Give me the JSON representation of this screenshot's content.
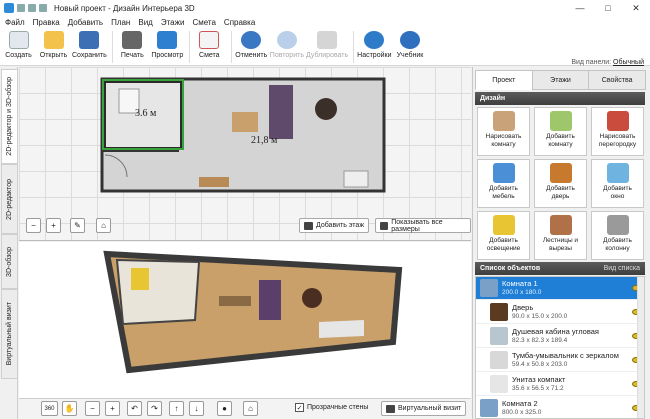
{
  "window": {
    "title": "Новый проект - Дизайн Интерьера 3D"
  },
  "menu": [
    "Файл",
    "Правка",
    "Добавить",
    "План",
    "Вид",
    "Этажи",
    "Смета",
    "Справка"
  ],
  "toolbar": {
    "create": "Создать",
    "open": "Открыть",
    "save": "Сохранить",
    "print": "Печать",
    "preview": "Просмотр",
    "estimate": "Смета",
    "undo": "Отменить",
    "redo": "Повторить",
    "duplicate": "Дублировать",
    "settings": "Настройки",
    "tutorial": "Учебник",
    "panel_view_label": "Вид панели:",
    "panel_view_value": "Обычный"
  },
  "left_tabs": [
    "2D-редактор и 3D-обзор",
    "2D-редактор",
    "3D-обзор",
    "Виртуальный визит"
  ],
  "plan2d": {
    "room_small_label": "3.6 м",
    "room_main_label": "21,8 м",
    "add_floor": "Добавить этаж",
    "show_all_sizes": "Показывать все размеры"
  },
  "view3d": {
    "zoom_label": "360",
    "transparent_walls": "Прозрачные стены",
    "virtual_visit": "Виртуальный визит"
  },
  "right_panel": {
    "tabs": [
      "Проект",
      "Этажи",
      "Свойства"
    ],
    "design_title": "Дизайн",
    "design_buttons": [
      {
        "line1": "Нарисовать",
        "line2": "комнату",
        "color": "#c9a27a"
      },
      {
        "line1": "Добавить",
        "line2": "комнату",
        "color": "#9dc76a"
      },
      {
        "line1": "Нарисовать",
        "line2": "перегородку",
        "color": "#c94c3c"
      },
      {
        "line1": "Добавить",
        "line2": "мебель",
        "color": "#4b8fd6"
      },
      {
        "line1": "Добавить",
        "line2": "дверь",
        "color": "#c77a2e"
      },
      {
        "line1": "Добавить",
        "line2": "окно",
        "color": "#6fb3e0"
      },
      {
        "line1": "Добавить",
        "line2": "освещение",
        "color": "#e8c533"
      },
      {
        "line1": "Лестницы и",
        "line2": "вырезы",
        "color": "#b07048"
      },
      {
        "line1": "Добавить",
        "line2": "колонну",
        "color": "#9a9a9a"
      }
    ],
    "objects_title": "Список объектов",
    "objects_view": "Вид списка",
    "objects": [
      {
        "name": "Комната 1",
        "dims": "200.0 x 180.0",
        "selected": true,
        "child": false,
        "color": "#7aa0c8"
      },
      {
        "name": "Дверь",
        "dims": "90.0 x 15.0 x 200.0",
        "selected": false,
        "child": true,
        "color": "#5a3b22"
      },
      {
        "name": "Душевая кабина угловая",
        "dims": "82.3 x 82.3 x 189.4",
        "selected": false,
        "child": true,
        "color": "#b8c6cf"
      },
      {
        "name": "Тумба-умывальник с зеркалом",
        "dims": "59.4 x 50.8 x 203.0",
        "selected": false,
        "child": true,
        "color": "#d8d8d8"
      },
      {
        "name": "Унитаз компакт",
        "dims": "35.6 x 56.5 x 71.2",
        "selected": false,
        "child": true,
        "color": "#e6e6e6"
      },
      {
        "name": "Комната 2",
        "dims": "800.0 x 325.0",
        "selected": false,
        "child": false,
        "color": "#7aa0c8"
      }
    ]
  }
}
